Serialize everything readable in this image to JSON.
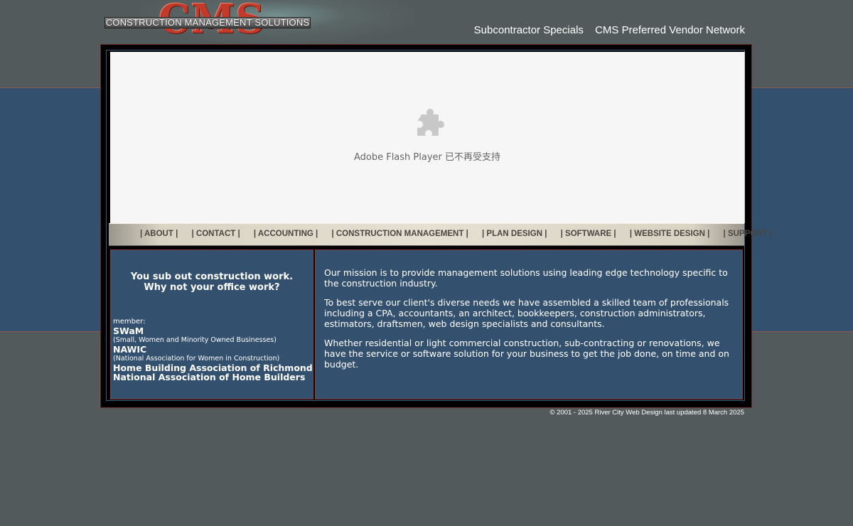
{
  "header": {
    "logo_text": "CMS",
    "logo_subtitle": "CONSTRUCTION MANAGEMENT SOLUTIONS",
    "top_links": [
      "Subcontractor Specials",
      "CMS Preferred Vendor Network"
    ]
  },
  "flash": {
    "message": "Adobe Flash Player 已不再受支持",
    "icon": "puzzle-piece-icon"
  },
  "nav": {
    "items": [
      "| ABOUT |",
      "| CONTACT |",
      "| ACCOUNTING |",
      "| CONSTRUCTION MANAGEMENT |",
      "| PLAN DESIGN |",
      "| SOFTWARE |",
      "| WEBSITE DESIGN |",
      "| SUPPORT |"
    ]
  },
  "left_panel": {
    "slogan_line1": "You sub out construction work.",
    "slogan_line2": "Why not your office work?",
    "member_label": "member:",
    "members": [
      {
        "name": "SWaM",
        "detail": "(Small, Women and Minority Owned Businesses)"
      },
      {
        "name": "NAWIC",
        "detail": "(National Association for Women in Construction)"
      },
      {
        "name": "Home Building Association of Richmond",
        "detail": ""
      },
      {
        "name": "National Association of Home Builders",
        "detail": ""
      }
    ]
  },
  "right_panel": {
    "paragraphs": [
      "Our mission is to provide management solutions using leading edge technology specific to the construction industry.",
      "To best serve our client's diverse needs we have assembled a skilled team of professionals including a CPA, accountants, an architect, bookkeepers, construction administrators, estimators, draftsmen, web design specialists and consultants.",
      "Whether residential or light commercial construction, sub-contracting or renovations, we have the service or software solution for your business to get the job done, on time and on budget."
    ]
  },
  "footer": {
    "text": "© 2001 - 2025 River City Web Design last updated 8 March 2025"
  },
  "colors": {
    "page_bg": "#535a5b",
    "band_blue": "#34506f",
    "logo_red": "#c23a2a"
  }
}
